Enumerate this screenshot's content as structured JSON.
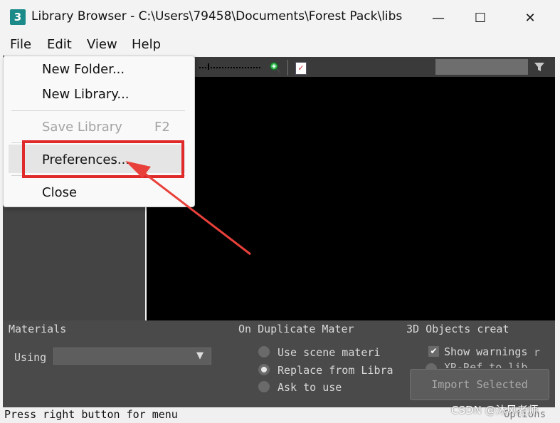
{
  "window": {
    "app_icon": "3",
    "title": "Library Browser - C:\\Users\\79458\\Documents\\Forest Pack\\libs",
    "minimize": "—",
    "maximize": "☐",
    "close": "✕"
  },
  "menubar": [
    "File",
    "Edit",
    "View",
    "Help"
  ],
  "file_menu": {
    "new_folder": "New Folder...",
    "new_library": "New Library...",
    "save_library": "Save Library",
    "save_shortcut": "F2",
    "preferences": "Preferences...",
    "close": "Close"
  },
  "materials": {
    "section": "Materials",
    "using_label": "Using",
    "using_value": ""
  },
  "duplicate": {
    "section": "On Duplicate Mater",
    "options": [
      "Use scene materi",
      "Replace from Libra",
      "Ask to use"
    ],
    "selected_index": 1
  },
  "objects": {
    "section": "3D Objects creat",
    "show_warnings": "Show warnings",
    "show_warnings_checked": true,
    "suffix": "r",
    "partial_line": "XR-Ref to lib"
  },
  "import_button": "Import Selected",
  "status": "Press right button for menu",
  "options_label": "Options",
  "watermark": "CSDN @沐风老师",
  "colors": {
    "highlight_box": "#e02a2a",
    "arrow": "#e8403a"
  }
}
